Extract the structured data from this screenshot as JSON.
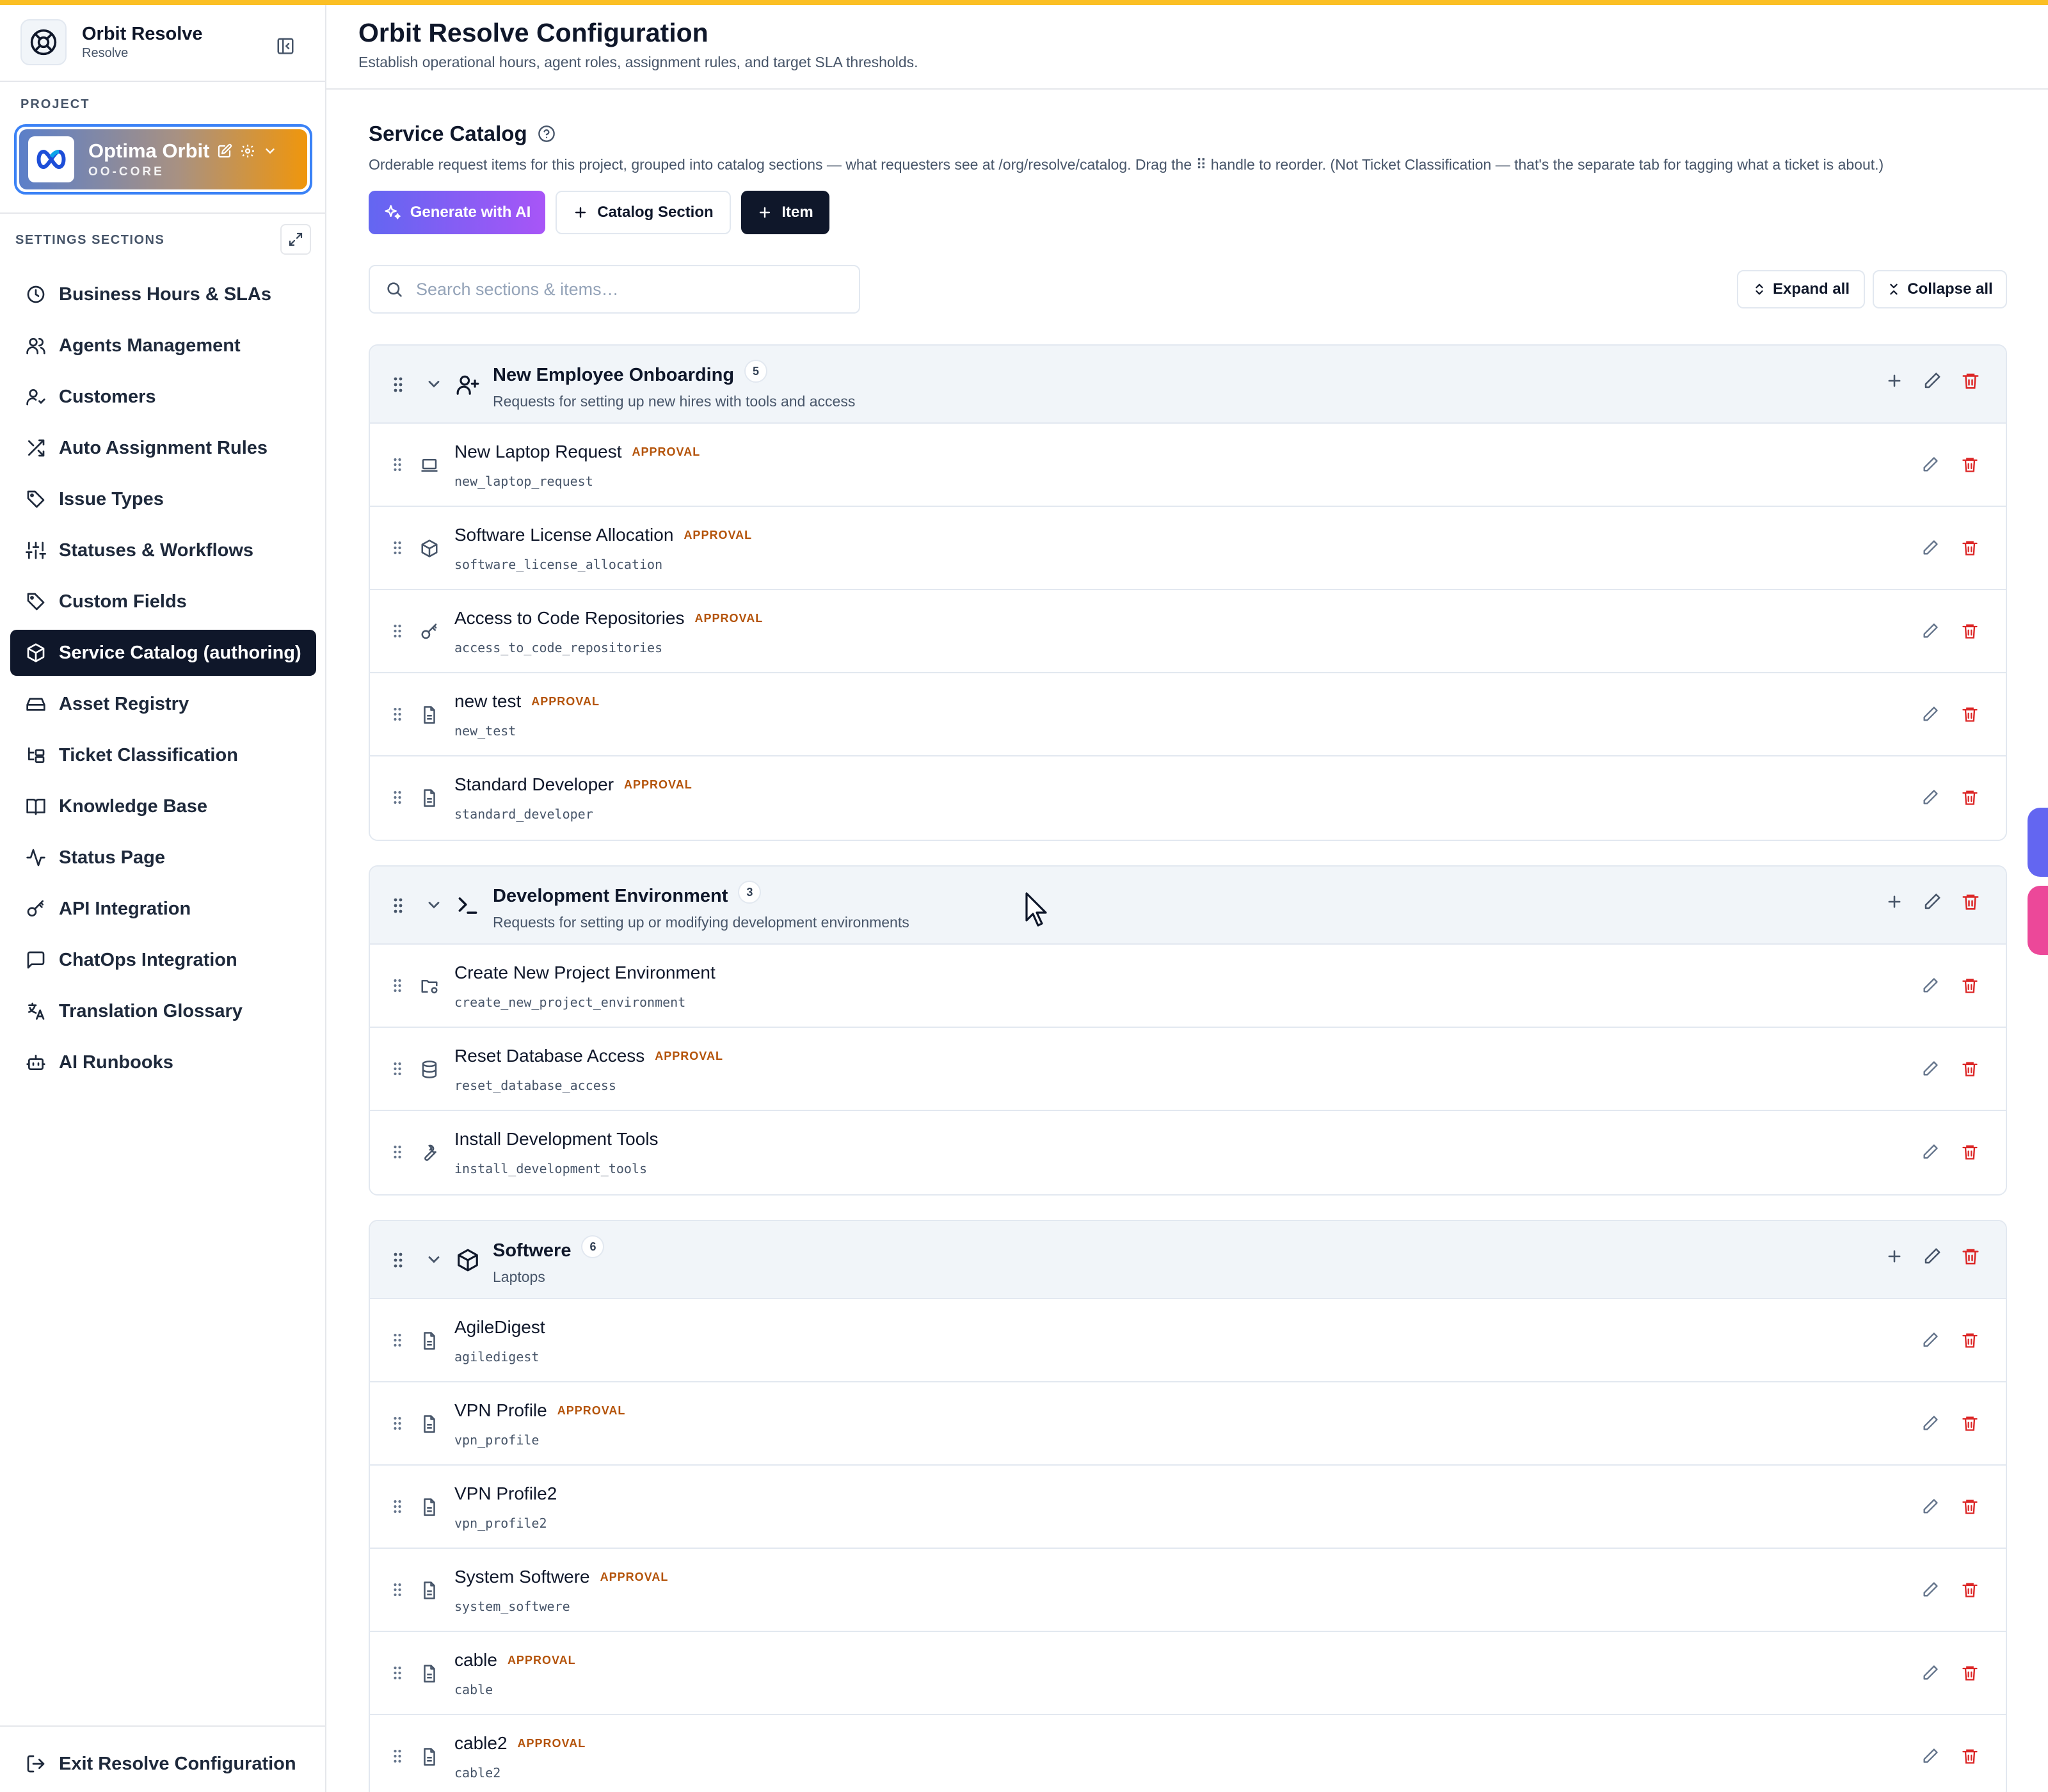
{
  "app": {
    "name": "Orbit Resolve",
    "subtitle": "Resolve"
  },
  "project": {
    "label": "PROJECT",
    "name": "Optima Orbit",
    "code": "OO-CORE"
  },
  "sidebar": {
    "section_label": "SETTINGS SECTIONS",
    "items": [
      {
        "label": "Business Hours & SLAs",
        "icon": "clock-icon"
      },
      {
        "label": "Agents Management",
        "icon": "users-icon"
      },
      {
        "label": "Customers",
        "icon": "user-check-icon"
      },
      {
        "label": "Auto Assignment Rules",
        "icon": "shuffle-icon"
      },
      {
        "label": "Issue Types",
        "icon": "tag-icon"
      },
      {
        "label": "Statuses & Workflows",
        "icon": "sliders-icon"
      },
      {
        "label": "Custom Fields",
        "icon": "tag-icon"
      },
      {
        "label": "Service Catalog (authoring)",
        "icon": "package-icon",
        "active": true
      },
      {
        "label": "Asset Registry",
        "icon": "hard-drive-icon"
      },
      {
        "label": "Ticket Classification",
        "icon": "folder-tree-icon"
      },
      {
        "label": "Knowledge Base",
        "icon": "book-open-icon"
      },
      {
        "label": "Status Page",
        "icon": "activity-icon"
      },
      {
        "label": "API Integration",
        "icon": "key-icon"
      },
      {
        "label": "ChatOps Integration",
        "icon": "message-square-icon"
      },
      {
        "label": "Translation Glossary",
        "icon": "languages-icon"
      },
      {
        "label": "AI Runbooks",
        "icon": "bot-icon"
      }
    ],
    "exit_label": "Exit Resolve Configuration"
  },
  "header": {
    "title": "Orbit Resolve Configuration",
    "subtitle": "Establish operational hours, agent roles, assignment rules, and target SLA thresholds."
  },
  "catalog": {
    "title": "Service Catalog",
    "description": "Orderable request items for this project, grouped into catalog sections — what requesters see at /org/resolve/catalog. Drag the ⠿ handle to reorder. (Not Ticket Classification — that's the separate tab for tagging what a ticket is about.)",
    "buttons": {
      "generate": "Generate with AI",
      "section": "Catalog Section",
      "item": "Item"
    },
    "search_placeholder": "Search sections & items…",
    "expand_all": "Expand all",
    "collapse_all": "Collapse all",
    "badge_label": "APPROVAL",
    "groups": [
      {
        "name": "New Employee Onboarding",
        "count": "5",
        "description": "Requests for setting up new hires with tools and access",
        "icon": "user-plus-icon",
        "items": [
          {
            "name": "New Laptop Request",
            "key": "new_laptop_request",
            "approval": true,
            "icon": "laptop-icon"
          },
          {
            "name": "Software License Allocation",
            "key": "software_license_allocation",
            "approval": true,
            "icon": "package-icon"
          },
          {
            "name": "Access to Code Repositories",
            "key": "access_to_code_repositories",
            "approval": true,
            "icon": "key-icon"
          },
          {
            "name": "new test",
            "key": "new_test",
            "approval": true,
            "icon": "file-icon"
          },
          {
            "name": "Standard Developer",
            "key": "standard_developer",
            "approval": true,
            "icon": "file-icon"
          }
        ]
      },
      {
        "name": "Development Environment",
        "count": "3",
        "description": "Requests for setting up or modifying development environments",
        "icon": "terminal-icon",
        "items": [
          {
            "name": "Create New Project Environment",
            "key": "create_new_project_environment",
            "approval": false,
            "icon": "folder-cog-icon"
          },
          {
            "name": "Reset Database Access",
            "key": "reset_database_access",
            "approval": true,
            "icon": "database-icon"
          },
          {
            "name": "Install Development Tools",
            "key": "install_development_tools",
            "approval": false,
            "icon": "wrench-icon"
          }
        ]
      },
      {
        "name": "Softwere",
        "count": "6",
        "description": "Laptops",
        "icon": "package-icon",
        "items": [
          {
            "name": "AgileDigest",
            "key": "agiledigest",
            "approval": false,
            "icon": "file-icon"
          },
          {
            "name": "VPN Profile",
            "key": "vpn_profile",
            "approval": true,
            "icon": "file-icon"
          },
          {
            "name": "VPN Profile2",
            "key": "vpn_profile2",
            "approval": false,
            "icon": "file-icon"
          },
          {
            "name": "System Softwere",
            "key": "system_softwere",
            "approval": true,
            "icon": "file-icon"
          },
          {
            "name": "cable",
            "key": "cable",
            "approval": true,
            "icon": "file-icon"
          },
          {
            "name": "cable2",
            "key": "cable2",
            "approval": true,
            "icon": "file-icon"
          }
        ]
      }
    ]
  },
  "colors": {
    "accent_top": "#fbbf24",
    "active_nav": "#0f172a",
    "badge": "#b45309",
    "delete": "#dc2626"
  }
}
